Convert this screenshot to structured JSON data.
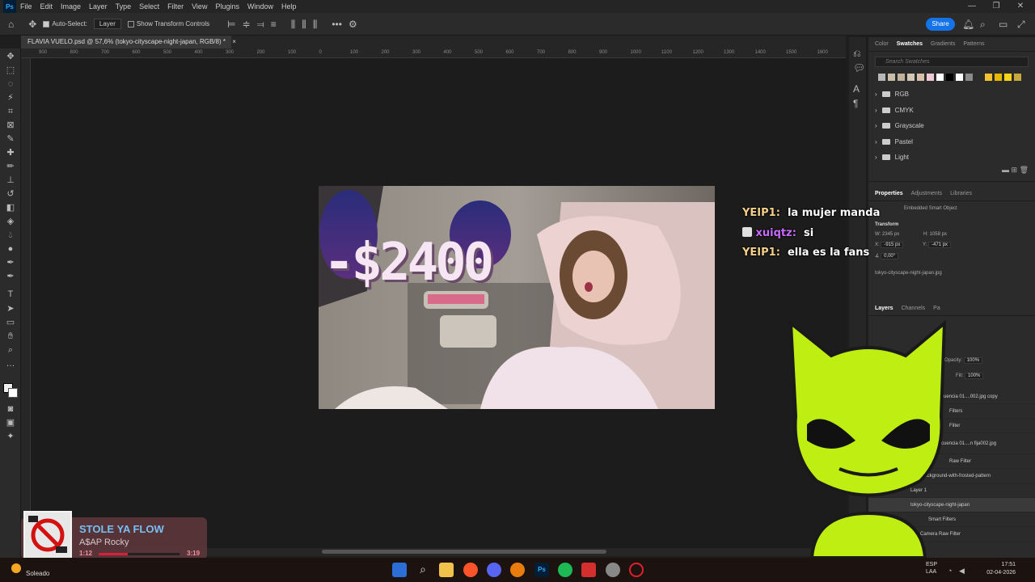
{
  "app": {
    "logo": "Ps",
    "menus": [
      "File",
      "Edit",
      "Image",
      "Layer",
      "Type",
      "Select",
      "Filter",
      "View",
      "Plugins",
      "Window",
      "Help"
    ],
    "window_controls": [
      "—",
      "❐",
      "✕"
    ]
  },
  "options_bar": {
    "auto_select_label": "Auto-Select:",
    "auto_select_checked": true,
    "auto_select_value": "Layer",
    "transform_label": "Show Transform Controls",
    "more": "•••",
    "share_label": "Share"
  },
  "document": {
    "tab_title": "FLAVIA VUELO.psd @ 57,6% (tokyo-cityscape-night-japan, RGB/8) *",
    "close": "×",
    "ruler_ticks": [
      "900",
      "800",
      "700",
      "600",
      "500",
      "400",
      "300",
      "200",
      "100",
      "0",
      "100",
      "200",
      "300",
      "400",
      "500",
      "600",
      "700",
      "800",
      "900",
      "1000",
      "1100",
      "1200",
      "1300",
      "1400",
      "1500",
      "1600"
    ],
    "overlay_text": "-$2400"
  },
  "panels": {
    "top_tabs": [
      "Color",
      "Swatches",
      "Gradients",
      "Patterns"
    ],
    "active_top_tab": "Swatches",
    "search_placeholder": "Search Swatches",
    "swatch_colors": [
      "#b8b8b8",
      "#c9bfa8",
      "#bfb19a",
      "#d1c7b2",
      "#d7bfa9",
      "#f0c9d7",
      "#ffffff",
      "#000000",
      "#ffffff",
      "#8a8a8a",
      "#f1c232",
      "#e6b800",
      "#f7d417",
      "#c8a93d"
    ],
    "swatch_groups": [
      "RGB",
      "CMYK",
      "Grayscale",
      "Pastel",
      "Light"
    ],
    "mid_tabs": [
      "Properties",
      "Adjustments",
      "Libraries"
    ],
    "active_mid_tab": "Properties",
    "properties": {
      "kind": "Embedded Smart Object",
      "section": "Transform",
      "w_label": "W:",
      "w_value": "2345 px",
      "h_label": "H:",
      "h_value": "1058 px",
      "x_label": "X:",
      "x_value": "-915 px",
      "y_label": "Y:",
      "y_value": "-471 px",
      "angle": "0,00°",
      "file": "tokyo-cityscape-night-japan.jpg"
    },
    "bottom_tabs": [
      "Layers",
      "Channels",
      "Pa"
    ],
    "active_bottom_tab": "Layers",
    "opacity_label": "Opacity:",
    "opacity_value": "100%",
    "fill_label": "Fill:",
    "fill_value": "100%",
    "layers": [
      "cuencia 01....002.jpg copy",
      "Filters",
      "Filter",
      "cuencia 01....n fija002.jpg",
      "Raw Filter",
      "-background-with-frosted-pattern",
      "Layer 1",
      "tokyo-cityscape-night-japan",
      "Smart Filters",
      "Camera Raw Filter"
    ]
  },
  "chat": [
    {
      "user": "YEIP1:",
      "message": "la mujer manda"
    },
    {
      "user": "xuiqtz:",
      "message": "si"
    },
    {
      "user": "YEIP1:",
      "message": "ella es la fans"
    }
  ],
  "music": {
    "title": "STOLE YA FLOW",
    "artist": "A$AP Rocky",
    "current": "1:12",
    "total": "3:19",
    "progress": 0.36
  },
  "taskbar": {
    "weather": "Soleado",
    "lang_1": "ESP",
    "lang_2": "LAA",
    "time": "17:51",
    "date": "02-04-2026"
  }
}
